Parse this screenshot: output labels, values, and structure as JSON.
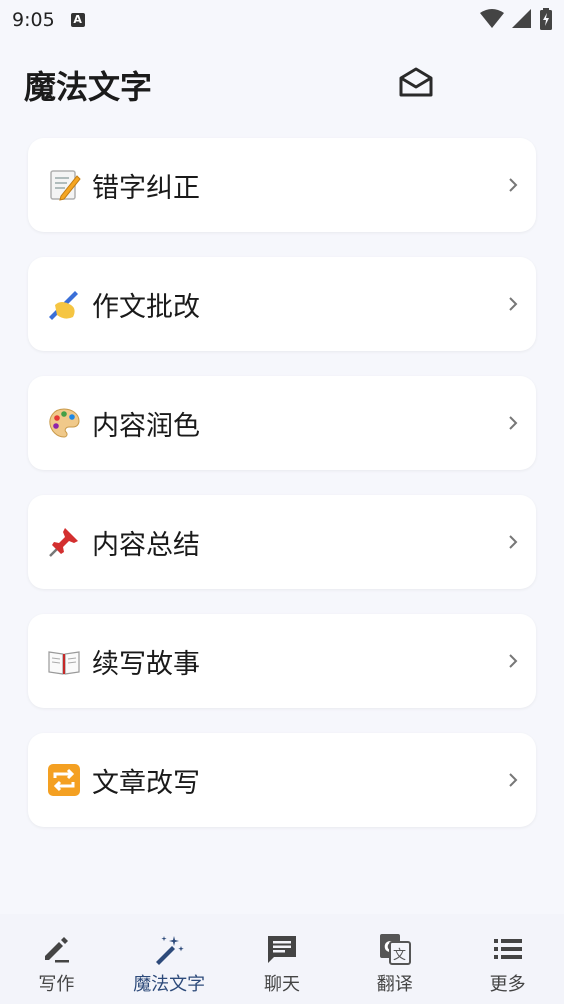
{
  "status_bar": {
    "time": "9:05",
    "indicator": "A"
  },
  "header": {
    "title": "魔法文字"
  },
  "menu": [
    {
      "emoji": "memo-icon",
      "label": "错字纠正"
    },
    {
      "emoji": "writing-hand-icon",
      "label": "作文批改"
    },
    {
      "emoji": "palette-icon",
      "label": "内容润色"
    },
    {
      "emoji": "pushpin-icon",
      "label": "内容总结"
    },
    {
      "emoji": "open-book-icon",
      "label": "续写故事"
    },
    {
      "emoji": "repeat-icon",
      "label": "文章改写"
    }
  ],
  "bottom_nav": [
    {
      "label": "写作",
      "icon": "pencil-icon"
    },
    {
      "label": "魔法文字",
      "icon": "magic-wand-icon",
      "active": true
    },
    {
      "label": "聊天",
      "icon": "chat-icon"
    },
    {
      "label": "翻译",
      "icon": "translate-icon"
    },
    {
      "label": "更多",
      "icon": "list-icon"
    }
  ],
  "colors": {
    "background": "#f6f7fc",
    "card": "#ffffff",
    "active_nav": "#2d4a7a"
  }
}
